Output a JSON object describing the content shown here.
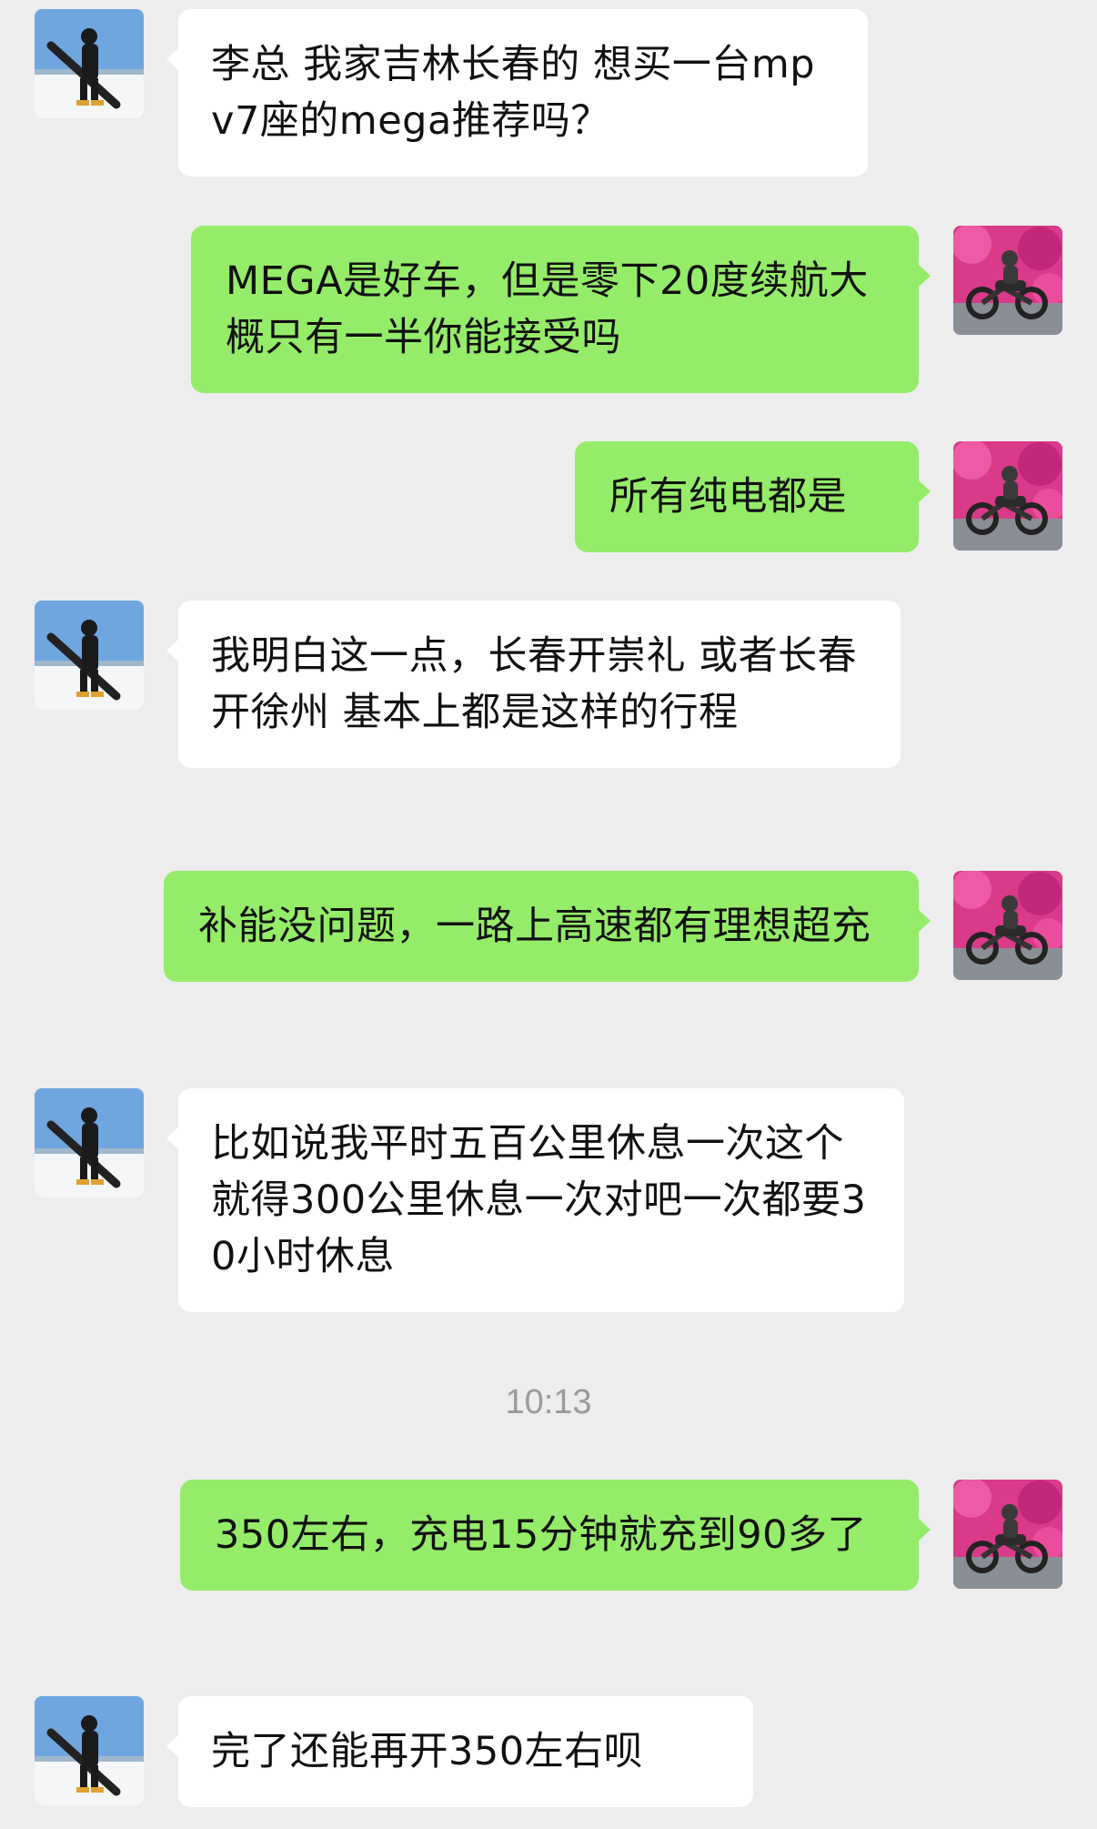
{
  "messages": [
    {
      "side": "left",
      "text": "李总 我家吉林长春的 想买一台mpv7座的mega推荐吗？"
    },
    {
      "side": "right",
      "text": "MEGA是好车，但是零下20度续航大概只有一半你能接受吗"
    },
    {
      "side": "right",
      "text": "所有纯电都是"
    },
    {
      "side": "left",
      "text": "我明白这一点，长春开崇礼 或者长春开徐州 基本上都是这样的行程"
    },
    {
      "side": "right",
      "text": "补能没问题，一路上高速都有理想超充"
    },
    {
      "side": "left",
      "text": "比如说我平时五百公里休息一次这个就得300公里休息一次对吧一次都要30小时休息"
    },
    {
      "side": "right",
      "text": "350左右，充电15分钟就充到90多了"
    },
    {
      "side": "left",
      "text": "完了还能再开350左右呗"
    }
  ],
  "timestamp": "10:13",
  "colors": {
    "background": "#ededed",
    "incoming_bubble": "#ffffff",
    "outgoing_bubble": "#95ec69",
    "timestamp_text": "#9a9a9a"
  },
  "avatars": {
    "contact": "snowboarder-avatar",
    "self": "motorcycle-rider-avatar"
  }
}
